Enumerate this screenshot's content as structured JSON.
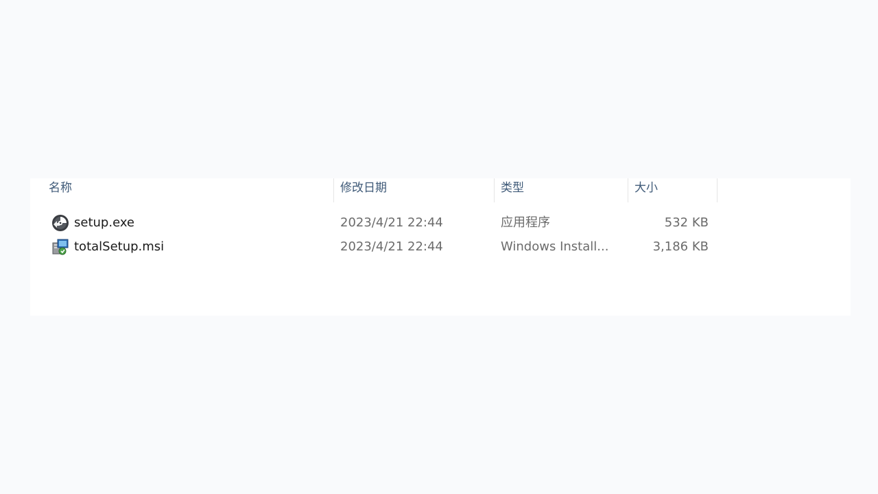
{
  "columns": {
    "name": "名称",
    "date": "修改日期",
    "type": "类型",
    "size": "大小"
  },
  "files": [
    {
      "name": "setup.exe",
      "date": "2023/4/21 22:44",
      "type": "应用程序",
      "size": "532 KB",
      "icon": "setup-disc-icon"
    },
    {
      "name": "totalSetup.msi",
      "date": "2023/4/21 22:44",
      "type": "Windows Install...",
      "size": "3,186 KB",
      "icon": "msi-installer-icon"
    }
  ]
}
